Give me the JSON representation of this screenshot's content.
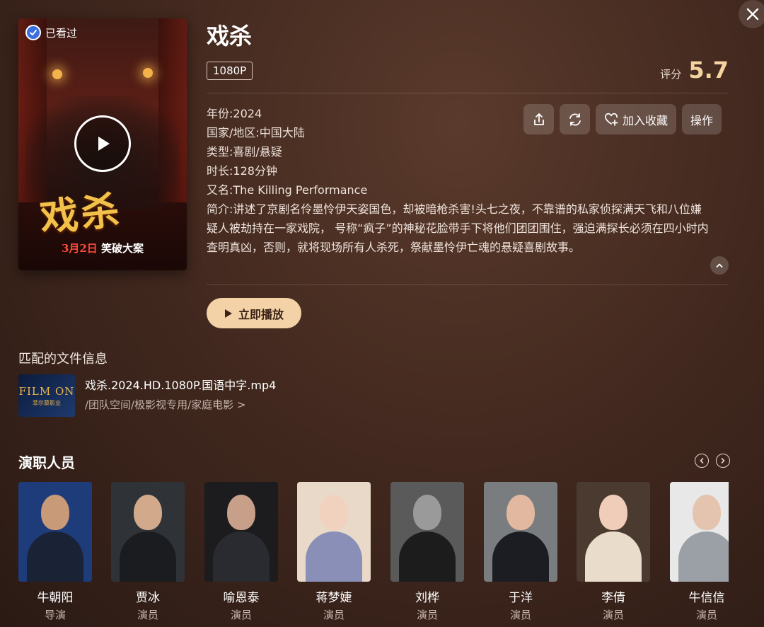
{
  "poster": {
    "watched_label": "已看过",
    "title_art": "戏杀",
    "date_text": "3月2日",
    "tagline": "笑破大案"
  },
  "movie": {
    "title": "戏杀",
    "quality": "1080P",
    "rating_label": "评分",
    "rating_value": "5.7",
    "year_label": "年份:",
    "year": "2024",
    "region_label": "国家/地区:",
    "region": "中国大陆",
    "genre_label": "类型:",
    "genre": "喜剧/悬疑",
    "duration_label": "时长:",
    "duration": "128分钟",
    "aka_label": "又名:",
    "aka": "The Killing Performance",
    "synopsis_label": "简介:",
    "synopsis": "讲述了京剧名伶墨怜伊天姿国色，却被暗枪杀害!头七之夜，不靠谱的私家侦探满天飞和八位嫌疑人被劫持在一家戏院， 号称“疯子”的神秘花脸带手下将他们团团围住，强迫满探长必须在四小时内查明真凶，否则，就将现场所有人杀死，祭献墨怜伊亡魂的悬疑喜剧故事。"
  },
  "actions": {
    "share_icon": "share-icon",
    "refresh_icon": "refresh-icon",
    "favorite_label": "加入收藏",
    "more_label": "操作"
  },
  "play_button": {
    "label": "立即播放"
  },
  "file_info": {
    "section_title": "匹配的文件信息",
    "thumb_text": "FILM ON",
    "thumb_sub": "菲尔慕影业",
    "file_name": "戏杀.2024.HD.1080P.国语中字.mp4",
    "file_path": "/团队空间/极影视专用/家庭电影 >"
  },
  "cast": {
    "section_title": "演职人员",
    "members": [
      {
        "name": "牛朝阳",
        "role": "导演",
        "bg": "#1f3c7a",
        "skin": "#c89a78",
        "cloth": "#1a2236"
      },
      {
        "name": "贾冰",
        "role": "演员",
        "bg": "#2f3338",
        "skin": "#d2a98a",
        "cloth": "#1b1c20"
      },
      {
        "name": "喻恩泰",
        "role": "演员",
        "bg": "#1c1c1e",
        "skin": "#c8a08a",
        "cloth": "#2a2b30"
      },
      {
        "name": "蒋梦婕",
        "role": "演员",
        "bg": "#e9d9c8",
        "skin": "#f1d2bf",
        "cloth": "#8a8fb8"
      },
      {
        "name": "刘桦",
        "role": "演员",
        "bg": "#5a5a5a",
        "skin": "#9a9a9a",
        "cloth": "#1c1c1c"
      },
      {
        "name": "于洋",
        "role": "演员",
        "bg": "#7a7d80",
        "skin": "#e2b9a0",
        "cloth": "#1c1d22"
      },
      {
        "name": "李倩",
        "role": "演员",
        "bg": "#4b3a30",
        "skin": "#efcdb8",
        "cloth": "#e9dccb"
      },
      {
        "name": "牛信信",
        "role": "演员",
        "bg": "#e8e8e8",
        "skin": "#e4c4ae",
        "cloth": "#9aa0a6"
      }
    ]
  }
}
